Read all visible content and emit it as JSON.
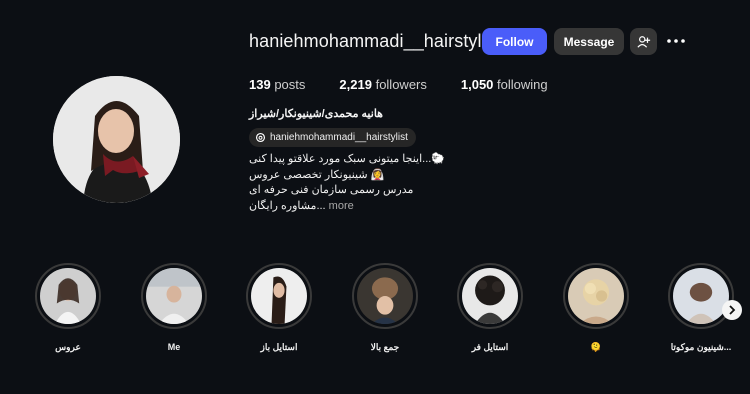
{
  "profile": {
    "username": "haniehmohammadi__hairstylist",
    "follow_label": "Follow",
    "message_label": "Message",
    "add_user_icon": "add-user-icon",
    "more_icon": "more-options-icon",
    "stats": {
      "posts_count": "139",
      "posts_label": "posts",
      "followers_count": "2,219",
      "followers_label": "followers",
      "following_count": "1,050",
      "following_label": "following"
    },
    "full_name": "هانیه محمدی/شینیونکار/شیراز",
    "threads_handle": "haniehmohammadi__hairstylist",
    "bio_lines": [
      "اینجا میتونی سبک مورد علاقتو پیدا کنی...🐑",
      "شینیونکار تخصصی عروس 👰‍♀️",
      "مدرس رسمی سازمان فنی حرفه ای",
      "مشاوره رایگان..."
    ],
    "more_label": "more"
  },
  "colors": {
    "background": "#0c0f14",
    "follow_button": "#4a5df9",
    "secondary_button": "#363636"
  },
  "highlights": [
    {
      "label": "عروس"
    },
    {
      "label": "Me"
    },
    {
      "label": "استایل باز"
    },
    {
      "label": "جمع بالا"
    },
    {
      "label": "استایل فر"
    },
    {
      "label": "🫠"
    },
    {
      "label": "شینیون موکوتا..."
    }
  ],
  "next_icon": "chevron-right-icon"
}
